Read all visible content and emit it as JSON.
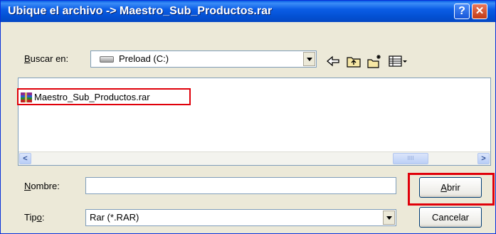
{
  "window": {
    "title": "Ubique el archivo -> Maestro_Sub_Productos.rar",
    "help_label": "?",
    "close_label": "✕"
  },
  "lookin": {
    "label_prefix": "",
    "label_accel": "B",
    "label_rest": "uscar en:",
    "value": "Preload (C:)"
  },
  "toolbar": {
    "icons": [
      "back-arrow-icon",
      "up-folder-icon",
      "new-folder-icon",
      "view-menu-icon"
    ]
  },
  "files": [
    {
      "name": "Maestro_Sub_Productos.rar",
      "icon": "rar-archive-icon",
      "highlighted": true
    }
  ],
  "scrollbar": {
    "left_arrow": "<",
    "right_arrow": ">",
    "thumb_grip": "IIII"
  },
  "filename": {
    "label_accel": "N",
    "label_rest": "ombre:",
    "value": ""
  },
  "filetype": {
    "label_pre": "Tip",
    "label_accel": "o",
    "label_post": ":",
    "value": "Rar (*.RAR)"
  },
  "buttons": {
    "open_accel": "A",
    "open_rest": "brir",
    "cancel": "Cancelar"
  },
  "colors": {
    "titlebar": "#0a5fe6",
    "highlight_box": "#e0000a",
    "dialog_bg": "#ece9d8"
  }
}
